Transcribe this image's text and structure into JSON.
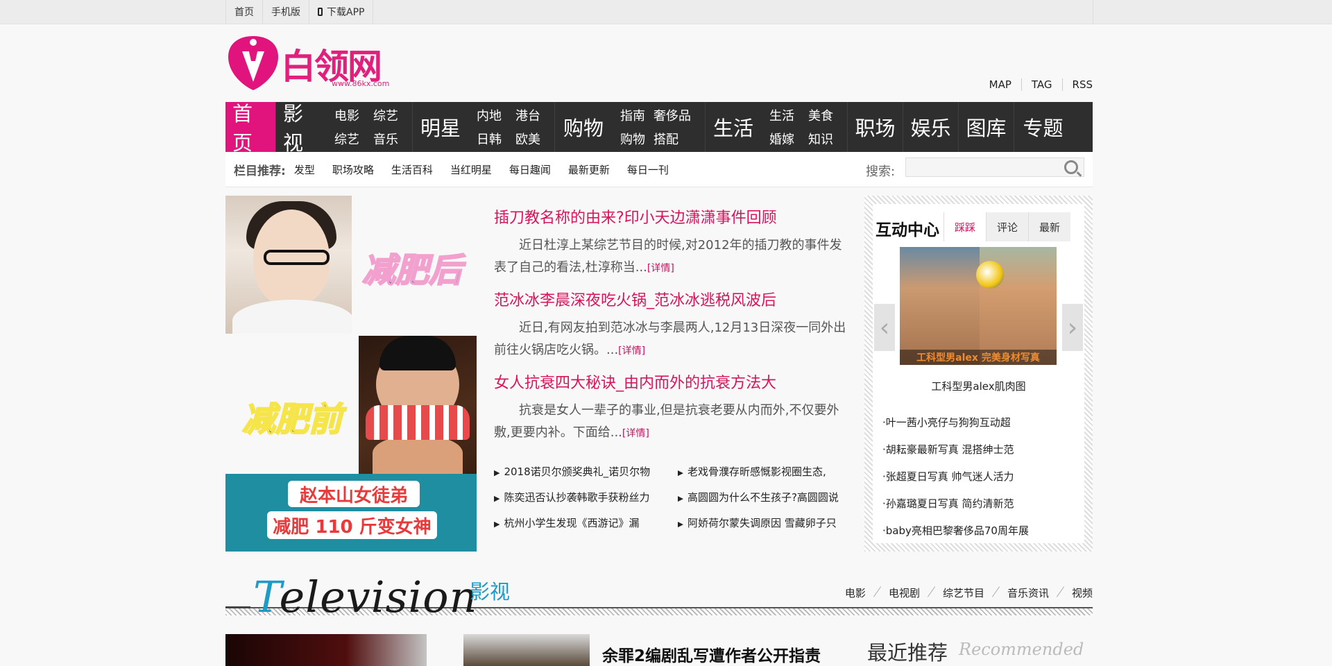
{
  "toplinks": {
    "home": "首页",
    "mobile": "手机版",
    "app": "下载APP"
  },
  "logo": {
    "name": "白领网",
    "url": "www.86kx.com"
  },
  "maplinks": [
    "MAP",
    "TAG",
    "RSS"
  ],
  "nav": {
    "home": "首页",
    "film": "影视",
    "film_sub": [
      "电影",
      "综艺",
      "综艺",
      "音乐"
    ],
    "star": "明星",
    "star_sub": [
      "内地",
      "港台",
      "日韩",
      "欧美"
    ],
    "shop": "购物",
    "shop_sub": [
      "指南",
      "奢侈品",
      "购物",
      "搭配"
    ],
    "life": "生活",
    "life_sub": [
      "生活",
      "美食",
      "婚嫁",
      "知识"
    ],
    "work": "职场",
    "fun": "娱乐",
    "gallery": "图库",
    "topic": "专题"
  },
  "recbar": {
    "label": "栏目推荐:",
    "items": [
      "发型",
      "职场攻略",
      "生活百科",
      "当红明星",
      "每日趣闻",
      "最新更新",
      "每日一刊"
    ],
    "search_label": "搜索:"
  },
  "feature": {
    "after": "减肥后",
    "before": "减肥前",
    "banner1": "赵本山女徒弟",
    "banner2": "减肥 110 斤变女神"
  },
  "articles": [
    {
      "title": "插刀教名称的由来?印小天边潇潇事件回顾",
      "desc": "近日杜淳上某综艺节目的时候,对2012年的插刀教的事件发表了自己的看法,杜淳称当...",
      "more": "[详情]"
    },
    {
      "title": "范冰冰李晨深夜吃火锅_范冰冰逃税风波后",
      "desc": "近日,有网友拍到范冰冰与李晨两人,12月13日深夜一同外出前往火锅店吃火锅。...",
      "more": "[详情]"
    },
    {
      "title": "女人抗衰四大秘诀_由内而外的抗衰方法大",
      "desc": "抗衰是女人一辈子的事业,但是抗衰老要从内而外,不仅要外敷,更要内补。下面给...",
      "more": "[详情]"
    }
  ],
  "news": [
    "2018诺贝尔颁奖典礼_诺贝尔物",
    "老戏骨濮存昕感慨影视圈生态,",
    "陈奕迅否认抄袭韩歌手获粉丝力",
    "高圆圆为什么不生孩子?高圆圆说",
    "杭州小学生发现《西游记》漏",
    "阿娇荷尔蒙失调原因 雪藏卵子只"
  ],
  "interact": {
    "title": "互动中心",
    "tabs": [
      "踩踩",
      "评论",
      "最新"
    ],
    "slide_caption": "工科型男alex 完美身材写真",
    "slide_title": "工科型男alex肌肉图",
    "prev": "‹",
    "next": "›",
    "items": [
      "·叶一茜小亮仔与狗狗互动超",
      "·胡耘豪最新写真 混搭绅士范",
      "·张超夏日写真 帅气迷人活力",
      "·孙嘉璐夏日写真 简约清新范",
      "·baby亮相巴黎奢侈品70周年展"
    ]
  },
  "tv": {
    "word_first": "T",
    "word_rest": "elevision",
    "cn": "影视",
    "links": [
      "电影",
      "电视剧",
      "综艺节目",
      "音乐资讯",
      "视频"
    ]
  },
  "bottom": {
    "headline": "余罪2编剧乱写遭作者公开指责",
    "rec_cn": "最近推荐",
    "rec_en": "Recommended"
  },
  "colors": {
    "brand": "#e0147c",
    "nav_bg": "#2e2e2e",
    "link_red": "#d8145c",
    "tv_blue": "#1f9bc7"
  }
}
